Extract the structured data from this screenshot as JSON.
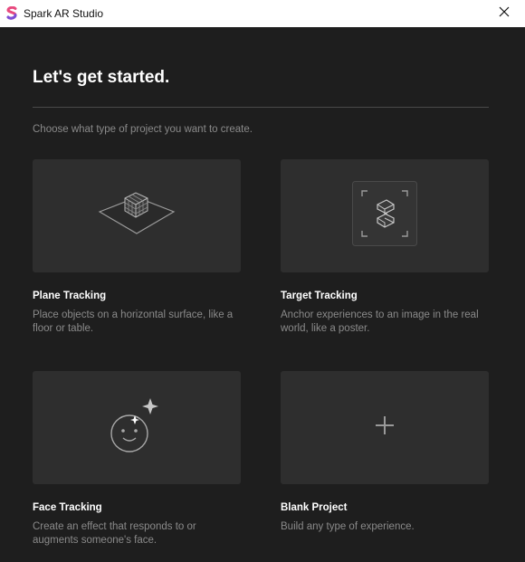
{
  "window": {
    "title": "Spark AR Studio",
    "app_icon": "spark-ar-logo-icon",
    "close_icon": "close-icon"
  },
  "main": {
    "heading": "Let's get started.",
    "subtitle": "Choose what type of project you want to create."
  },
  "cards": [
    {
      "title": "Plane Tracking",
      "description": "Place objects on a horizontal surface, like a floor or table.",
      "icon": "cube-on-plane-icon"
    },
    {
      "title": "Target Tracking",
      "description": "Anchor experiences to an image in the real world, like a poster.",
      "icon": "target-frame-icon"
    },
    {
      "title": "Face Tracking",
      "description": "Create an effect that responds to or augments someone's face.",
      "icon": "face-sparkle-icon"
    },
    {
      "title": "Blank Project",
      "description": "Build any type of experience.",
      "icon": "plus-icon"
    }
  ],
  "colors": {
    "background": "#1e1e1e",
    "card": "#2e2e2e",
    "text_primary": "#ffffff",
    "text_secondary": "#8a8a8a",
    "titlebar": "#ffffff"
  }
}
